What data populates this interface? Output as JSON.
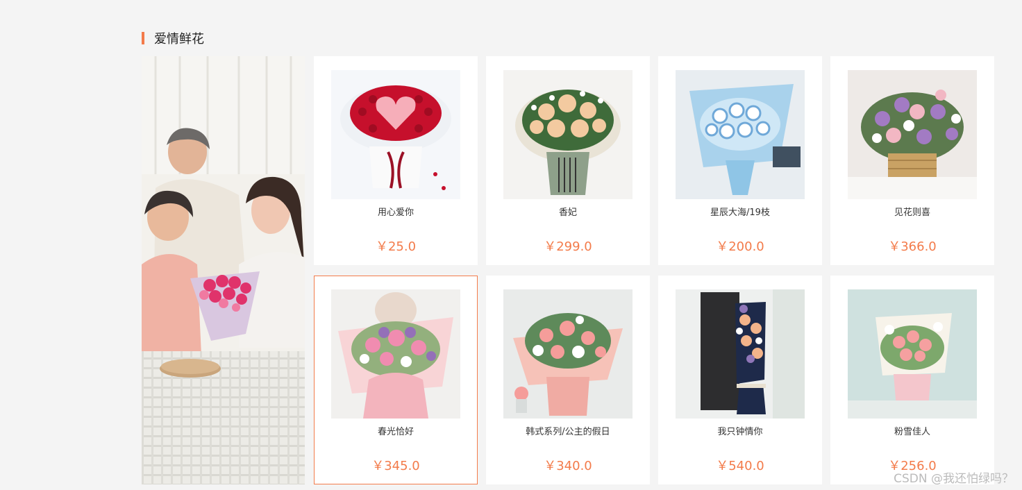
{
  "section": {
    "title": "爱情鲜花"
  },
  "products": [
    {
      "name": "用心爱你",
      "price": "￥25.0",
      "style": "red-heart"
    },
    {
      "name": "香妃",
      "price": "￥299.0",
      "style": "champagne-rose"
    },
    {
      "name": "星辰大海/19枝",
      "price": "￥200.0",
      "style": "blue-rose"
    },
    {
      "name": "见花则喜",
      "price": "￥366.0",
      "style": "purple-basket"
    },
    {
      "name": "春光恰好",
      "price": "￥345.0",
      "style": "pink-mixed"
    },
    {
      "name": "韩式系列/公主的假日",
      "price": "￥340.0",
      "style": "korean-pink"
    },
    {
      "name": "我只钟情你",
      "price": "￥540.0",
      "style": "navy-box"
    },
    {
      "name": "粉雪佳人",
      "price": "￥256.0",
      "style": "pink-lily"
    }
  ],
  "watermark": "CSDN @我还怕绿吗？",
  "colors": {
    "accent": "#f37b4a",
    "background": "#f4f4f4"
  }
}
